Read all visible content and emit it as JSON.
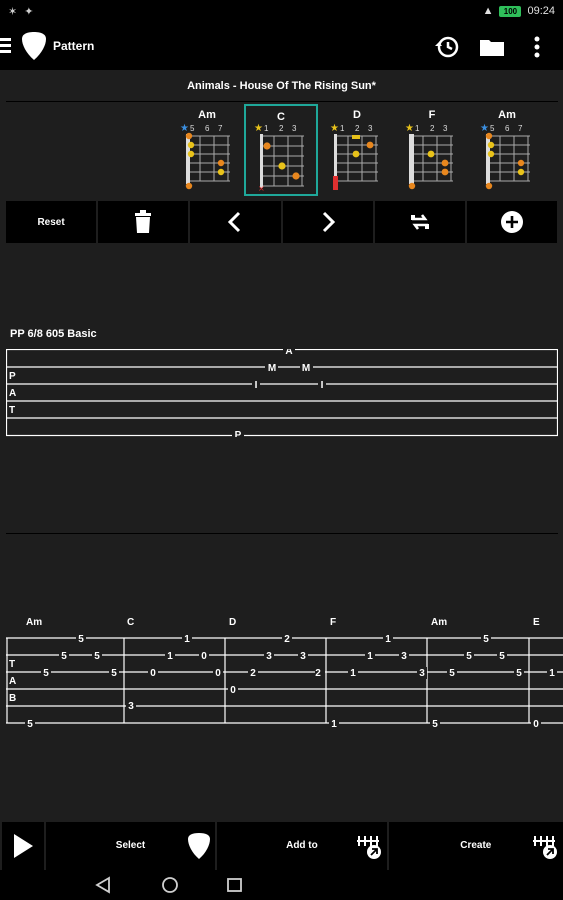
{
  "status_bar": {
    "left_icons": "✶ ✦",
    "time": "09:24",
    "battery_label": "100"
  },
  "app_bar": {
    "title": "Pattern",
    "icons": [
      "menu-icon",
      "guitar-pick-icon",
      "history-icon",
      "folder-icon",
      "more-vert-icon"
    ]
  },
  "song": {
    "title": "Animals - House Of The Rising Sun*"
  },
  "chords": [
    {
      "name": "Am",
      "frets": [
        "5",
        "6",
        "7"
      ],
      "star_color": "#3b8fe0",
      "selected": false
    },
    {
      "name": "C",
      "frets": [
        "1",
        "2",
        "3"
      ],
      "star_color": "#e8c21a",
      "selected": true
    },
    {
      "name": "D",
      "frets": [
        "1",
        "2",
        "3"
      ],
      "star_color": "#e8c21a",
      "selected": false
    },
    {
      "name": "F",
      "frets": [
        "1",
        "2",
        "3"
      ],
      "star_color": "#e8c21a",
      "selected": false
    },
    {
      "name": "Am",
      "frets": [
        "5",
        "6",
        "7"
      ],
      "star_color": "#3b8fe0",
      "selected": false
    }
  ],
  "toolbar": {
    "reset_label": "Reset",
    "icons": [
      "trash-icon",
      "chevron-left-icon",
      "chevron-right-icon",
      "swap-icon",
      "add-circle-icon"
    ]
  },
  "pattern": {
    "name": "PP 6/8 605 Basic",
    "row_labels": [
      "P",
      "A",
      "T"
    ],
    "notes": [
      "A",
      "M",
      "M",
      "I",
      "I",
      "P"
    ]
  },
  "tab": {
    "row_labels": [
      "T",
      "A",
      "B"
    ],
    "chord_labels": [
      "Am",
      "C",
      "D",
      "F",
      "Am",
      "E"
    ],
    "measures": [
      [
        "5",
        "5",
        "5",
        "5",
        "5",
        "5"
      ],
      [
        "0",
        "1",
        "1",
        "0",
        "0",
        "3"
      ],
      [
        "2",
        "3",
        "3",
        "2",
        "2",
        "0"
      ],
      [
        "1",
        "1",
        "1",
        "3",
        "3",
        "1"
      ],
      [
        "5",
        "5",
        "5",
        "5",
        "5",
        "5"
      ],
      [
        "0",
        "1"
      ]
    ]
  },
  "bottom_bar": {
    "select_label": "Select",
    "add_to_label": "Add to",
    "create_label": "Create"
  },
  "colors": {
    "accent": "#1fa89a",
    "note_orange": "#e8871e",
    "note_yellow": "#e8c21a",
    "background": "#1e1e1e"
  }
}
